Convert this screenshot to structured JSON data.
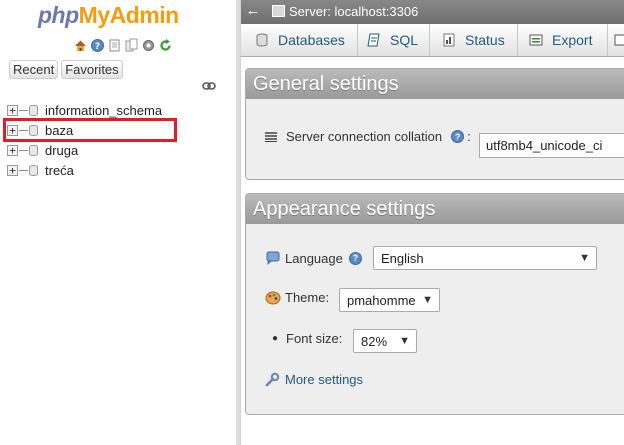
{
  "nav": {
    "logo_part1": "php",
    "logo_part2": "MyAdmin",
    "tabs": [
      {
        "label": "Recent"
      },
      {
        "label": "Favorites"
      }
    ],
    "databases": [
      {
        "name": "information_schema"
      },
      {
        "name": "baza"
      },
      {
        "name": "druga"
      },
      {
        "name": "treća"
      }
    ],
    "icons": [
      "home-icon",
      "help-icon",
      "docs-icon",
      "copy-icon",
      "settings-icon",
      "reload-icon",
      "link-icon"
    ]
  },
  "serverbar": {
    "text": "Server: localhost:3306"
  },
  "tabs": [
    {
      "label": "Databases"
    },
    {
      "label": "SQL"
    },
    {
      "label": "Status"
    },
    {
      "label": "Export"
    }
  ],
  "general": {
    "title": "General settings",
    "collation_label": "Server connection collation",
    "collation_value": "utf8mb4_unicode_ci"
  },
  "appearance": {
    "title": "Appearance settings",
    "language_label": "Language",
    "language_value": "English",
    "theme_label": "Theme:",
    "theme_value": "pmahomme",
    "fontsize_label": "Font size:",
    "fontsize_value": "82%",
    "more_settings": "More settings"
  },
  "colors": {
    "highlight": "#e11d2a",
    "link": "#235a81",
    "logo_php": "#6c78af",
    "logo_admin": "#f89c0e"
  }
}
